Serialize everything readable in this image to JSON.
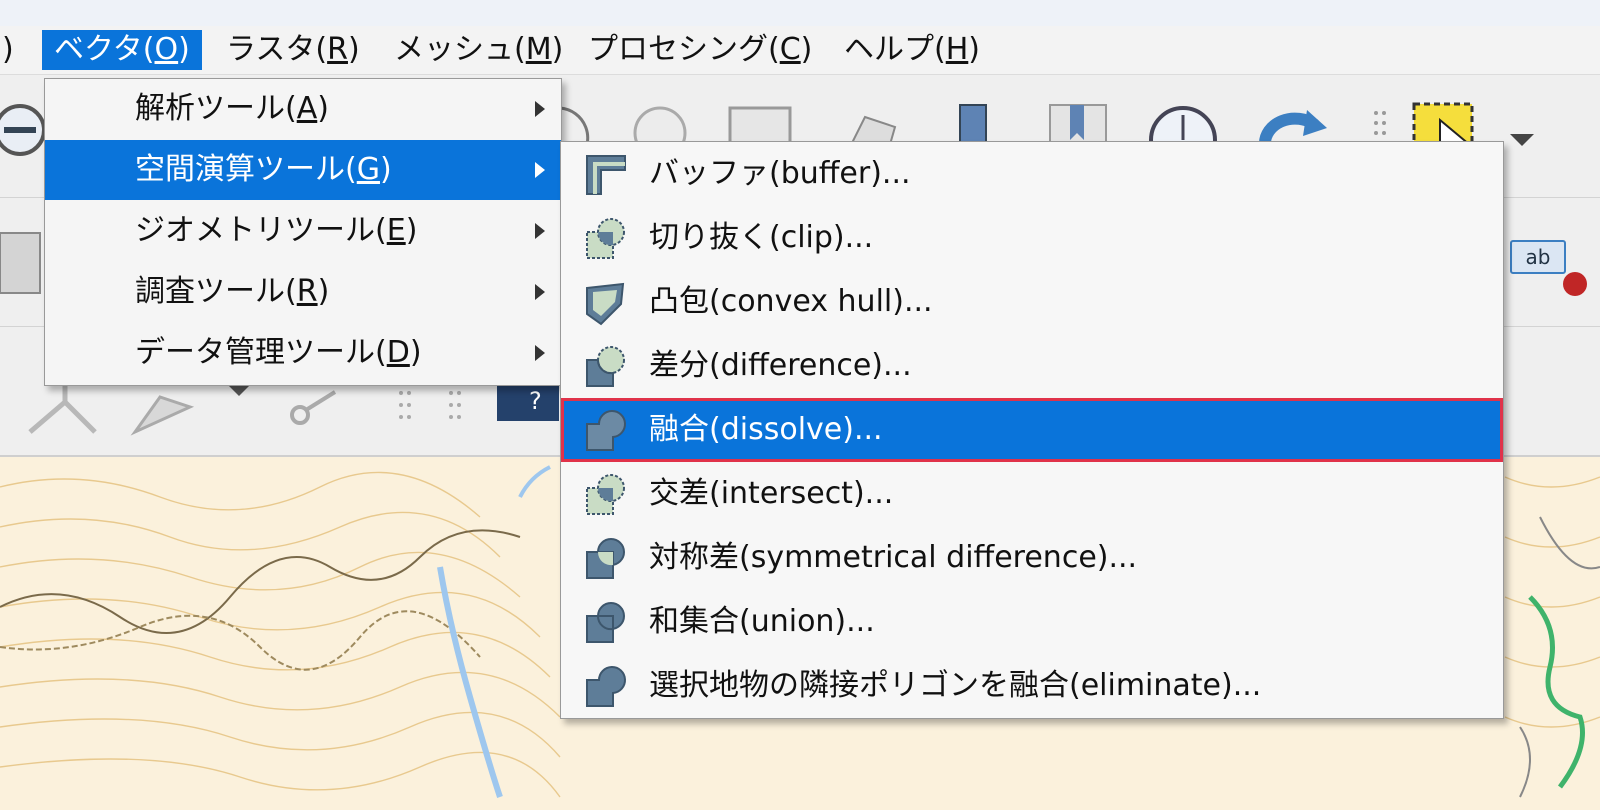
{
  "menubar": {
    "partial_label": ")",
    "items": [
      {
        "label": "ベクタ(",
        "key": "O",
        "close": ")"
      },
      {
        "label": "ラスタ(",
        "key": "R",
        "close": ")"
      },
      {
        "label": "メッシュ(",
        "key": "M",
        "close": ")"
      },
      {
        "label": "プロセシング(",
        "key": "C",
        "close": ")"
      },
      {
        "label": "ヘルプ(",
        "key": "H",
        "close": ")"
      }
    ]
  },
  "vector_menu": {
    "items": [
      {
        "label": "解析ツール(",
        "key": "A",
        "close": ")"
      },
      {
        "label": "空間演算ツール(",
        "key": "G",
        "close": ")"
      },
      {
        "label": "ジオメトリツール(",
        "key": "E",
        "close": ")"
      },
      {
        "label": "調査ツール(",
        "key": "R",
        "close": ")"
      },
      {
        "label": "データ管理ツール(",
        "key": "D",
        "close": ")"
      }
    ],
    "selected_index": 1
  },
  "geoprocessing_submenu": {
    "items": [
      {
        "label": "バッファ(buffer)...",
        "icon": "buffer-icon"
      },
      {
        "label": "切り抜く(clip)...",
        "icon": "clip-icon"
      },
      {
        "label": "凸包(convex hull)...",
        "icon": "convex-hull-icon"
      },
      {
        "label": "差分(difference)...",
        "icon": "difference-icon"
      },
      {
        "label": "融合(dissolve)...",
        "icon": "dissolve-icon"
      },
      {
        "label": "交差(intersect)...",
        "icon": "intersect-icon"
      },
      {
        "label": "対称差(symmetrical difference)...",
        "icon": "symmetrical-difference-icon"
      },
      {
        "label": "和集合(union)...",
        "icon": "union-icon"
      },
      {
        "label": "選択地物の隣接ポリゴンを融合(eliminate)...",
        "icon": "eliminate-icon"
      }
    ],
    "highlighted_index": 4
  },
  "toolbar": {
    "label_badge": "ab"
  },
  "colors": {
    "menu_highlight": "#0a74da",
    "highlight_border": "#e0324a",
    "icon_fill": "#5e7d98",
    "icon_light_fill": "#c9dcc5"
  }
}
